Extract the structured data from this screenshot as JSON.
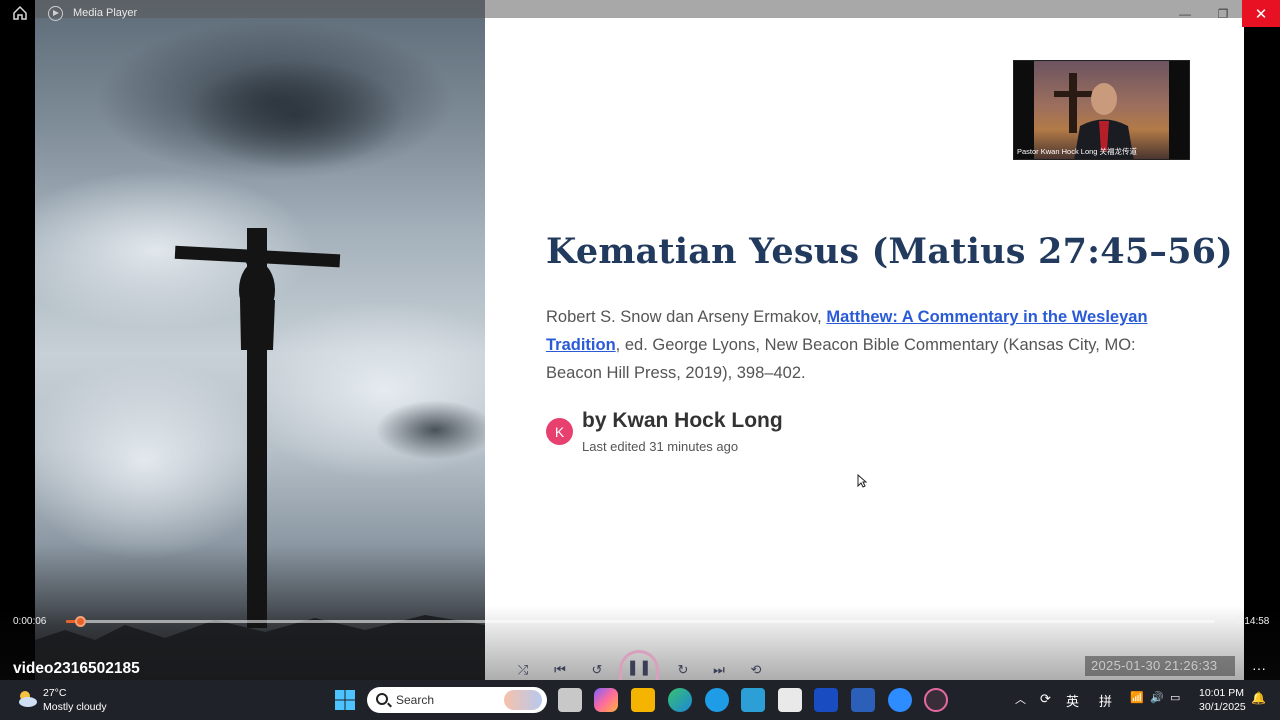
{
  "window": {
    "title": "Media Player",
    "minimize": "—",
    "restore": "❐",
    "close": "✕"
  },
  "slide": {
    "title": "Kematian Yesus (Matius 27:45–56)",
    "citation_prefix": "Robert S. Snow dan Arseny Ermakov, ",
    "citation_link": "Matthew: A Commentary in the Wesleyan Tradition",
    "citation_suffix": ", ed. George Lyons, New Beacon Bible Commentary (Kansas City, MO: Beacon Hill Press, 2019), 398–402.",
    "author_initial": "K",
    "author_name": "by Kwan Hock Long",
    "last_edited": "Last edited 31 minutes ago"
  },
  "webcam": {
    "caption": "Pastor Kwan Hock Long 关福龙传道"
  },
  "player": {
    "current_time": "0:00:06",
    "total_time": "0:14:58",
    "progress": 0.007,
    "video_title": "video2316502185",
    "timestamp_overlay": "2025-01-30 21:26:33",
    "more": "···",
    "accent_color": "#e8632a"
  },
  "controls": {
    "shuffle": "⤮",
    "previous": "⏮",
    "rewind": "↺",
    "play_pause": "❚❚",
    "forward": "↻",
    "next": "⏭",
    "repeat": "⟲"
  },
  "taskbar": {
    "weather_temp": "27°C",
    "weather_desc": "Mostly cloudy",
    "search_label": "Search",
    "ime_1": "英",
    "ime_2": "拼",
    "clock_time": "10:01 PM",
    "clock_date": "30/1/2025"
  }
}
